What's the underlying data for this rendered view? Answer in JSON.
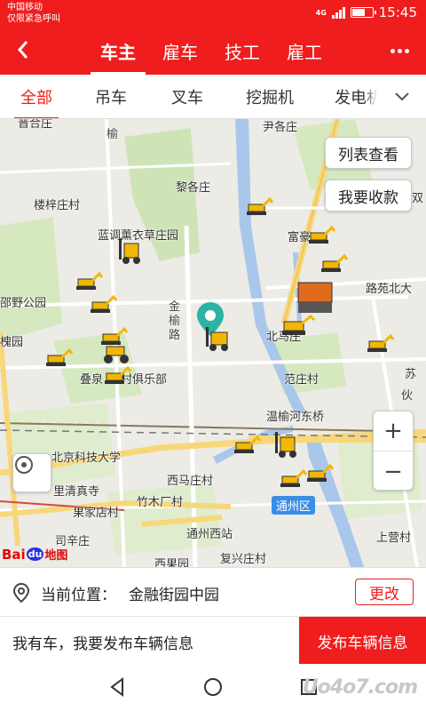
{
  "status_bar": {
    "carrier_line1": "中国移动",
    "carrier_line2": "仅限紧急呼叫",
    "network": "4G",
    "time": "15:45"
  },
  "app_bar": {
    "back_icon": "chevron-left-icon",
    "tabs": [
      {
        "label": "车主",
        "active": true
      },
      {
        "label": "雇车",
        "active": false
      },
      {
        "label": "技工",
        "active": false
      },
      {
        "label": "雇工",
        "active": false
      }
    ],
    "more_icon": "more-dots-icon"
  },
  "categories": {
    "items": [
      {
        "label": "全部",
        "active": true
      },
      {
        "label": "吊车",
        "active": false
      },
      {
        "label": "叉车",
        "active": false
      },
      {
        "label": "挖掘机",
        "active": false
      },
      {
        "label": "发电机",
        "active": false
      }
    ],
    "expand_icon": "chevron-down-icon"
  },
  "map": {
    "buttons": {
      "list_view": "列表查看",
      "favorites": "我要收款"
    },
    "labels": {
      "l1": "晋合庄",
      "l2": "尹各庄",
      "l3": "黎各庄",
      "l4": "楼梓庄村",
      "l5": "蓝调薰衣草庄园",
      "l6": "双",
      "l7": "富豪",
      "l8": "路苑北大",
      "l9": "邵野公园",
      "l10": "北马庄",
      "l11": "槐园",
      "l12": "叠泉",
      "l13": "村俱乐部",
      "l14": "范庄村",
      "l15": "苏",
      "l16": "伙",
      "l17": "温榆河东桥",
      "l18": "北京科技大学",
      "l19": "西马庄村",
      "l20": "里清真寺",
      "l21": "竹木厂村",
      "l22": "果家店村",
      "l23": "通州区",
      "l24": "司辛庄",
      "l25": "通州西站",
      "l26": "复兴庄村",
      "l27": "西果园",
      "l28": "上营村",
      "l29": "通",
      "road1": "榆",
      "road2": "金",
      "road3": "榆",
      "road4": "路"
    },
    "zoom_in_icon": "plus-icon",
    "zoom_out_icon": "minus-icon",
    "locate_icon": "locate-icon",
    "logo": {
      "bai": "Bai",
      "du": "du",
      "tu": "地图"
    }
  },
  "location_bar": {
    "pin_icon": "location-pin-icon",
    "label": "当前位置：",
    "value": "金融街园中园",
    "change_button": "更改"
  },
  "action_bar": {
    "message": "我有车，我要发布车辆信息",
    "publish_button": "发布车辆信息"
  },
  "nav_bar": {
    "back_icon": "nav-back-icon",
    "home_icon": "nav-home-icon",
    "recents_icon": "nav-recents-icon",
    "watermark": "Uo4o7.com"
  },
  "colors": {
    "brand_red": "#ef1d1d",
    "map_bg": "#ecebe6",
    "water": "#a9c7ea",
    "green": "#cfe4b6",
    "road_yellow": "#f8d77a"
  }
}
